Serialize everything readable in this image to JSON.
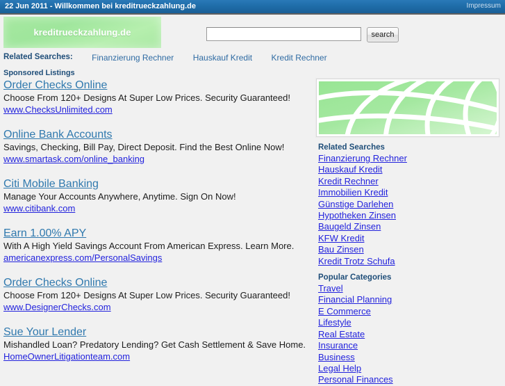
{
  "topbar": {
    "title": "22 Jun 2011 - Willkommen bei kreditrueckzahlung.de",
    "impressum": "Impressum"
  },
  "header": {
    "logo_text": "kreditrueckzahlung.de",
    "search_value": "",
    "search_placeholder": "",
    "search_button": "search"
  },
  "related_bar": {
    "label": "Related Searches:",
    "links": [
      "Finanzierung Rechner",
      "Hauskauf Kredit",
      "Kredit Rechner"
    ]
  },
  "sponsored_label": "Sponsored Listings",
  "listings": [
    {
      "title": "Order Checks Online",
      "desc": "Choose From 120+ Designs At Super Low Prices. Security Guaranteed!",
      "url": "www.ChecksUnlimited.com"
    },
    {
      "title": "Online Bank Accounts",
      "desc": "Savings, Checking, Bill Pay, Direct Deposit. Find the Best Online Now!",
      "url": "www.smartask.com/online_banking"
    },
    {
      "title": "Citi Mobile Banking",
      "desc": "Manage Your Accounts Anywhere, Anytime. Sign On Now!",
      "url": "www.citibank.com"
    },
    {
      "title": "Earn 1.00% APY",
      "desc": "With A High Yield Savings Account From American Express. Learn More.",
      "url": "americanexpress.com/PersonalSavings"
    },
    {
      "title": "Order Checks Online",
      "desc": "Choose From 120+ Designs At Super Low Prices. Security Guaranteed!",
      "url": "www.DesignerChecks.com"
    },
    {
      "title": "Sue Your Lender",
      "desc": "Mishandled Loan? Predatory Lending? Get Cash Settlement & Save Home.",
      "url": "HomeOwnerLitigationteam.com"
    }
  ],
  "sidebar": {
    "banner_alt": "globe-banner",
    "related_heading": "Related Searches",
    "related_links": [
      "Finanzierung Rechner",
      "Hauskauf Kredit",
      "Kredit Rechner",
      "Immobilien Kredit",
      "Günstige Darlehen",
      "Hypotheken Zinsen",
      "Baugeld Zinsen",
      "KFW Kredit",
      "Bau Zinsen",
      "Kredit Trotz Schufa"
    ],
    "categories_heading": "Popular Categories",
    "category_links": [
      "Travel",
      "Financial Planning",
      "E Commerce",
      "Lifestyle",
      "Real Estate",
      "Insurance",
      "Business",
      "Legal Help",
      "Personal Finances"
    ]
  },
  "colors": {
    "topbar_blue": "#1f6da9",
    "heading_blue": "#1f4e79",
    "link_blue": "#2222dd",
    "title_blue": "#3079ae",
    "logo_green": "#9fe69c",
    "page_bg": "#f1f1f1"
  }
}
